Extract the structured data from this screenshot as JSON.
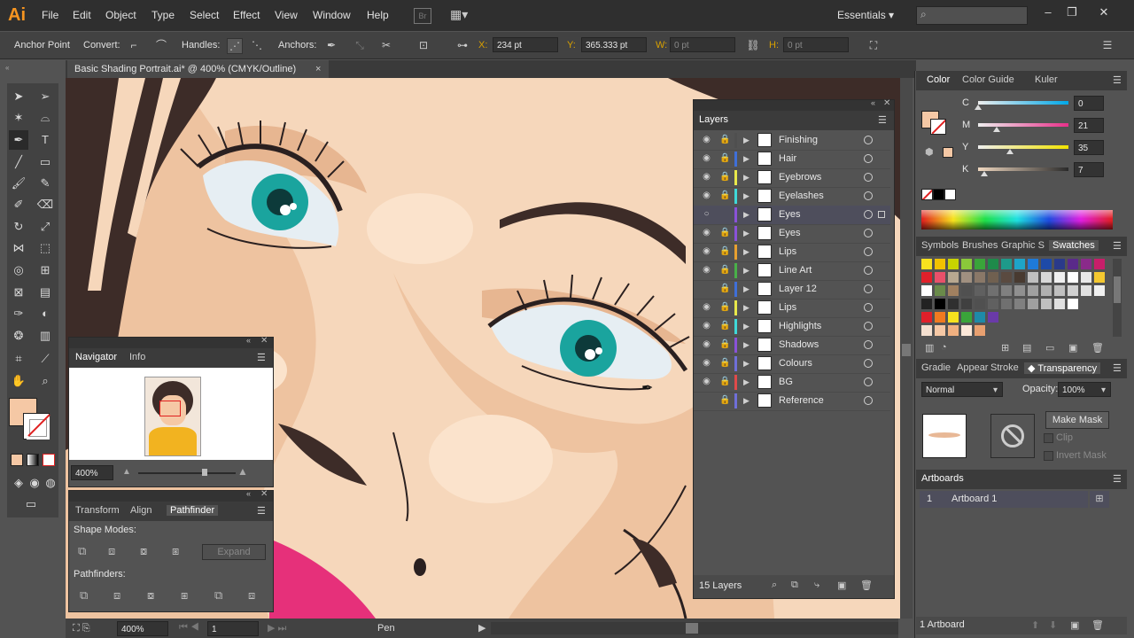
{
  "app": {
    "logo": "Ai",
    "workspace": "Essentials",
    "bridge_label": "Br"
  },
  "menu": [
    "File",
    "Edit",
    "Object",
    "Type",
    "Select",
    "Effect",
    "View",
    "Window",
    "Help"
  ],
  "control_bar": {
    "mode": "Anchor Point",
    "convert": "Convert:",
    "handles": "Handles:",
    "anchors": "Anchors:",
    "x_label": "X:",
    "x_value": "234 pt",
    "y_label": "Y:",
    "y_value": "365.333 pt",
    "w_label": "W:",
    "w_value": "0 pt",
    "h_label": "H:",
    "h_value": "0 pt"
  },
  "document": {
    "tab_title": "Basic Shading Portrait.ai* @ 400% (CMYK/Outline)"
  },
  "status": {
    "zoom": "400%",
    "artboard": "1",
    "tool": "Pen"
  },
  "navigator": {
    "tabs": [
      "Navigator",
      "Info"
    ],
    "zoom": "400%"
  },
  "pathfinder": {
    "tabs": [
      "Transform",
      "Align",
      "Pathfinder"
    ],
    "shape_modes": "Shape Modes:",
    "expand": "Expand",
    "pathfinders": "Pathfinders:"
  },
  "layers": {
    "title": "Layers",
    "count": "15 Layers",
    "items": [
      {
        "name": "Finishing",
        "color": "#4f4f4f"
      },
      {
        "name": "Hair",
        "color": "#3f6fd8"
      },
      {
        "name": "Eyebrows",
        "color": "#e8e84a"
      },
      {
        "name": "Eyelashes",
        "color": "#3fd8d8"
      },
      {
        "name": "Eyes",
        "color": "#8a52d8"
      },
      {
        "name": "Eyes",
        "color": "#8a52d8"
      },
      {
        "name": "Lips",
        "color": "#e8a030"
      },
      {
        "name": "Line Art",
        "color": "#49b049"
      },
      {
        "name": "Layer 12",
        "color": "#3f6fd8"
      },
      {
        "name": "Lips",
        "color": "#e8e84a"
      },
      {
        "name": "Highlights",
        "color": "#3fd8d8"
      },
      {
        "name": "Shadows",
        "color": "#8a52d8"
      },
      {
        "name": "Colours",
        "color": "#6f6fd8"
      },
      {
        "name": "BG",
        "color": "#e04a4a"
      },
      {
        "name": "Reference",
        "color": "#6f6fd8"
      }
    ]
  },
  "color_panel": {
    "tabs": [
      "Color",
      "Color Guide",
      "Kuler"
    ],
    "c_label": "C",
    "c_value": "0",
    "m_label": "M",
    "m_value": "21",
    "y_label": "Y",
    "y_value": "35",
    "k_label": "K",
    "k_value": "7",
    "c_level": 0,
    "m_level": 0.21,
    "y_level": 0.35,
    "k_level": 0.07
  },
  "swatches_panel": {
    "tabs": [
      "Symbols",
      "Brushes",
      "Graphic S",
      "Swatches"
    ]
  },
  "transparency_panel": {
    "tabs": [
      "Gradie",
      "Appear",
      "Stroke",
      "Transparency"
    ],
    "mode": "Normal",
    "opacity_label": "Opacity:",
    "opacity_value": "100%",
    "make_mask": "Make Mask",
    "clip": "Clip",
    "invert_mask": "Invert Mask"
  },
  "artboards_panel": {
    "title": "Artboards",
    "index": "1",
    "name": "Artboard 1",
    "footer": "1 Artboard"
  }
}
